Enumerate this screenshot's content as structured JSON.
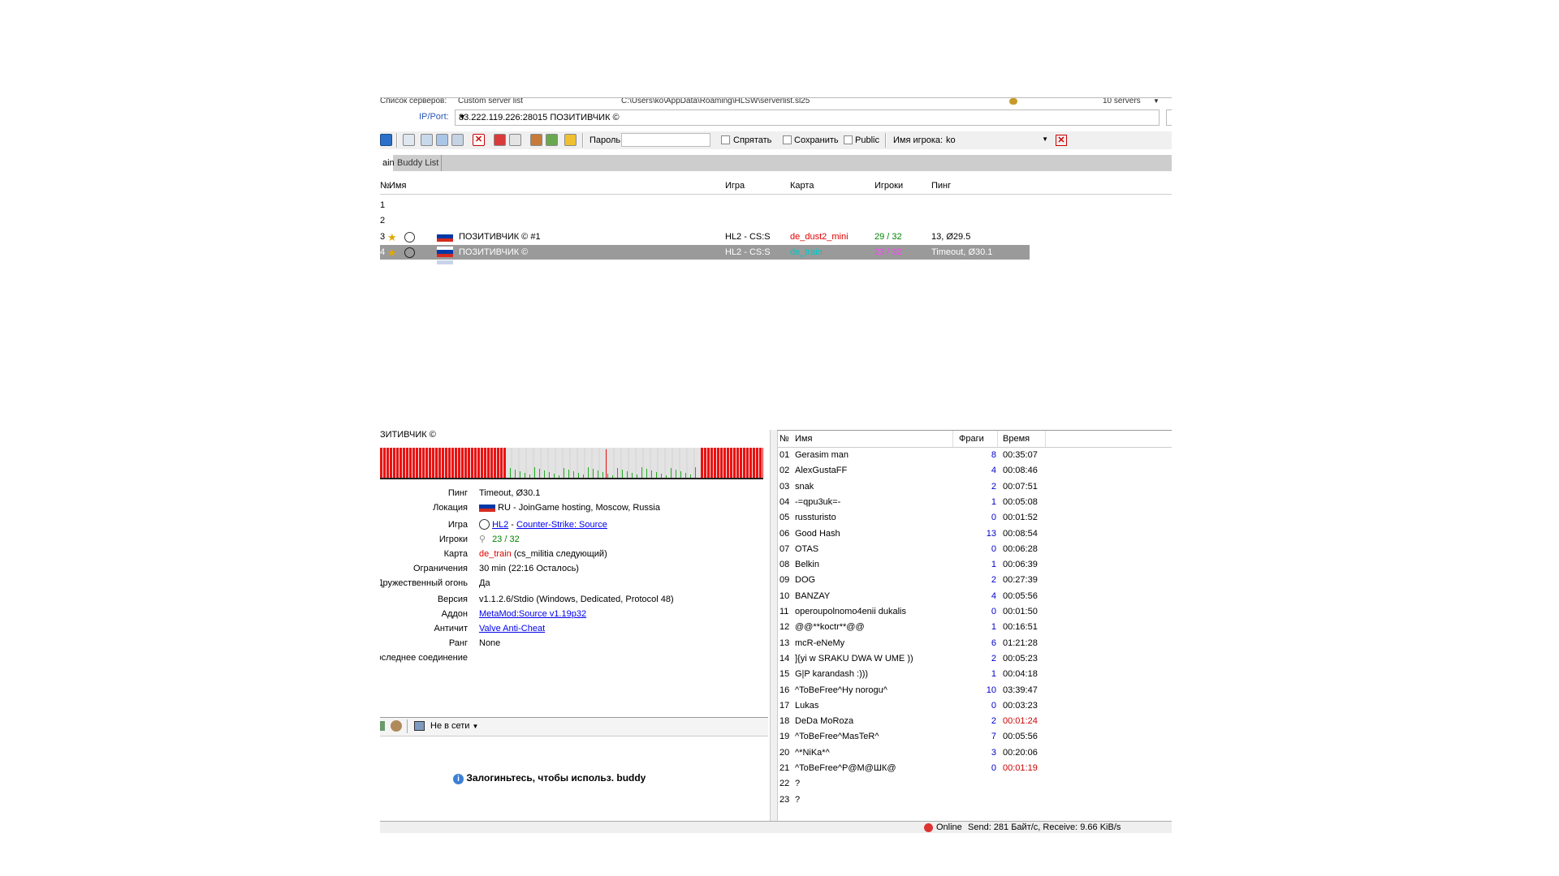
{
  "top": {
    "server_list_label": "Список серверов:",
    "server_list_value": "Custom server list",
    "server_list_path": "C:\\Users\\ko\\AppData\\Roaming\\HLSW\\serverlist.sl25",
    "server_count": "10 servers",
    "ip_label": "IP/Port:",
    "ip_value": "83.222.119.226:28015 ПОЗИТИВЧИК ©"
  },
  "toolbar": {
    "password_label": "Пароль:",
    "password_value": "",
    "hide_label": "Спрятать",
    "save_label": "Сохранить",
    "public_label": "Public",
    "player_name_label": "Имя игрока:",
    "player_name_value": "ko"
  },
  "tabs": [
    {
      "label": "ain"
    },
    {
      "label": "Buddy List"
    }
  ],
  "server_list": {
    "headers": {
      "num": "№",
      "name": "Имя",
      "game": "Игра",
      "map": "Карта",
      "players": "Игроки",
      "ping": "Пинг"
    },
    "rows": [
      {
        "num": "1",
        "name": "",
        "game": "",
        "map": "",
        "players": "",
        "ping": ""
      },
      {
        "num": "2",
        "name": "",
        "game": "",
        "map": "",
        "players": "",
        "ping": ""
      },
      {
        "num": "3",
        "name": "ПОЗИТИВЧИК © #1",
        "game": "HL2 - CS:S",
        "map": "de_dust2_mini",
        "players": "29 / 32",
        "ping": "13, Ø29.5"
      },
      {
        "num": "4",
        "name": "ПОЗИТИВЧИК ©",
        "game": "HL2 - CS:S",
        "map": "de_train",
        "players": "23 / 32",
        "ping": "Timeout, Ø30.1"
      }
    ]
  },
  "server_info": {
    "title": "ЗИТИВЧИК ©",
    "ping_label": "Пинг",
    "ping_value": "Timeout, Ø30.1",
    "location_label": "Локация",
    "location_value": "RU - JoinGame hosting, Moscow, Russia",
    "game_label": "Игра",
    "game_hl2": "HL2",
    "game_sep": " - ",
    "game_title": "Counter-Strike: Source",
    "players_label": "Игроки",
    "players_value": "23 / 32",
    "map_label": "Карта",
    "map_value": "de_train",
    "map_next": " (cs_militia следующий)",
    "limits_label": "Ограничения",
    "limits_value": "30 min (22:16 Осталось)",
    "ff_label": "Дружественный огонь",
    "ff_value": "Да",
    "version_label": "Версия",
    "version_value": "v1.1.2.6/Stdio (Windows, Dedicated, Protocol 48)",
    "addon_label": "Аддон",
    "addon_value": "MetaMod:Source v1.19p32",
    "anticheat_label": "Античит",
    "anticheat_value": "Valve Anti-Cheat",
    "rank_label": "Ранг",
    "rank_value": "None",
    "last_conn_label": "оследнее соединение"
  },
  "buddy": {
    "status": "Не в сети",
    "login_msg": "Залогиньтесь, чтобы использ. buddy"
  },
  "players": {
    "headers": {
      "num": "№",
      "name": "Имя",
      "frags": "Фраги",
      "time": "Время"
    },
    "rows": [
      {
        "num": "01",
        "name": "Gerasim man",
        "frags": "8",
        "time": "00:35:07"
      },
      {
        "num": "02",
        "name": "AlexGustaFF",
        "frags": "4",
        "time": "00:08:46"
      },
      {
        "num": "03",
        "name": "snak",
        "frags": "2",
        "time": "00:07:51"
      },
      {
        "num": "04",
        "name": "-=qpu3uk=-",
        "frags": "1",
        "time": "00:05:08"
      },
      {
        "num": "05",
        "name": "russturisto",
        "frags": "0",
        "time": "00:01:52"
      },
      {
        "num": "06",
        "name": "Good Hash",
        "frags": "13",
        "time": "00:08:54"
      },
      {
        "num": "07",
        "name": "OTAS",
        "frags": "0",
        "time": "00:06:28"
      },
      {
        "num": "08",
        "name": "Belkin",
        "frags": "1",
        "time": "00:06:39"
      },
      {
        "num": "09",
        "name": "DOG",
        "frags": "2",
        "time": "00:27:39"
      },
      {
        "num": "10",
        "name": "BANZAY",
        "frags": "4",
        "time": "00:05:56"
      },
      {
        "num": "11",
        "name": "operoupolnomo4enii dukalis",
        "frags": "0",
        "time": "00:01:50"
      },
      {
        "num": "12",
        "name": "@@**koctr**@@",
        "frags": "1",
        "time": "00:16:51"
      },
      {
        "num": "13",
        "name": "mcR-eNeMy",
        "frags": "6",
        "time": "01:21:28"
      },
      {
        "num": "14",
        "name": "]{yi w SRAKU DWA W UME ))",
        "frags": "2",
        "time": "00:05:23"
      },
      {
        "num": "15",
        "name": "G|P karandash :)))",
        "frags": "1",
        "time": "00:04:18"
      },
      {
        "num": "16",
        "name": "^ToBeFree^Hy norogu^",
        "frags": "10",
        "time": "03:39:47"
      },
      {
        "num": "17",
        "name": "Lukas",
        "frags": "0",
        "time": "00:03:23"
      },
      {
        "num": "18",
        "name": "DeDa MoRoza",
        "frags": "2",
        "time": "00:01:24",
        "red": true
      },
      {
        "num": "19",
        "name": "^ToBeFree^MasTeR^",
        "frags": "7",
        "time": "00:05:56"
      },
      {
        "num": "20",
        "name": "^*NiKa*^",
        "frags": "3",
        "time": "00:20:06"
      },
      {
        "num": "21",
        "name": "^ToBeFree^P@M@ШК@",
        "frags": "0",
        "time": "00:01:19",
        "red": true
      },
      {
        "num": "22",
        "name": "?",
        "frags": "",
        "time": ""
      },
      {
        "num": "23",
        "name": "?",
        "frags": "",
        "time": ""
      }
    ]
  },
  "status": {
    "online": "Online",
    "traffic": "Send: 281 Байт/с, Receive: 9.66 KiB/s"
  },
  "colors": {
    "map_red": "#e00000",
    "map_cyan": "#00c8c8",
    "players_green": "#008000",
    "players_magenta": "#ff40ff",
    "selected_row": "#9a9a9a",
    "time_red": "#cc0000"
  }
}
